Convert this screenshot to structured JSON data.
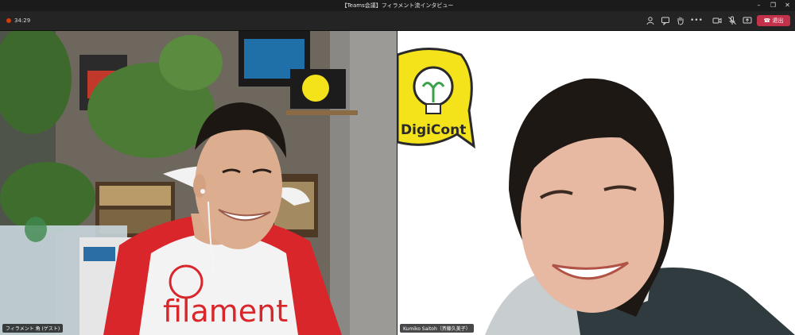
{
  "window": {
    "title": "【Teams会議】フィラメント流インタビュー"
  },
  "toolbar": {
    "timer": "34:29",
    "leave_label": "退出",
    "icons": [
      "people-icon",
      "chat-icon",
      "raise-hand-icon",
      "more-icon",
      "camera-icon",
      "mic-off-icon",
      "share-icon"
    ]
  },
  "participants": [
    {
      "name": "フィラメント 角 (ゲスト)",
      "shirt_logo": "filament"
    },
    {
      "name": "Kumiko Saitoh（斉藤久美子）",
      "logo_text": "DigiCont"
    }
  ],
  "colors": {
    "leave": "#c4314b",
    "shirt_red": "#d8262b",
    "logo_yellow": "#f4e21b"
  }
}
